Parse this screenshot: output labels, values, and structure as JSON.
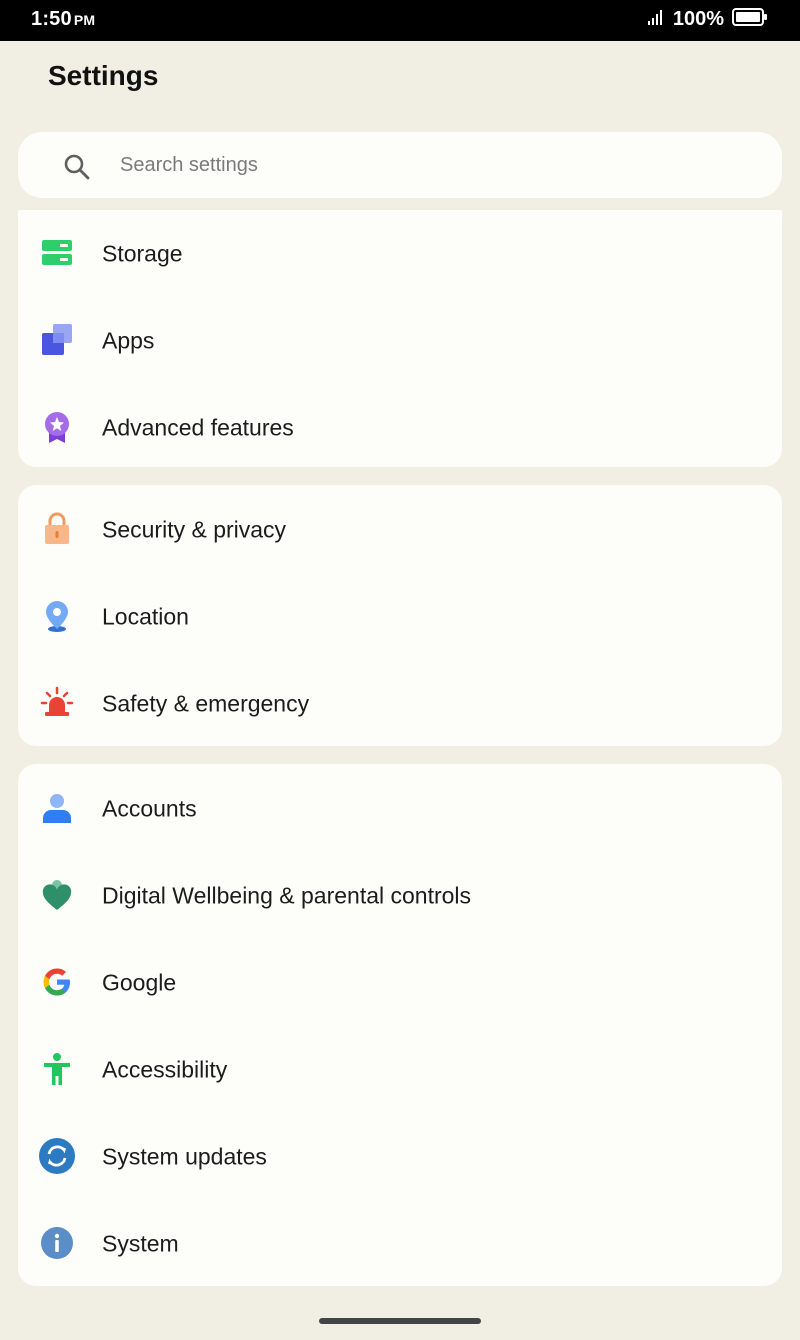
{
  "status_bar": {
    "time": "1:50",
    "ampm": "PM",
    "battery": "100%",
    "icons": [
      "signal-icon",
      "battery-icon"
    ]
  },
  "page": {
    "title": "Settings"
  },
  "search": {
    "placeholder": "Search settings",
    "icon": "search-icon"
  },
  "groups": [
    {
      "items": [
        {
          "label": "Storage",
          "icon": "storage-icon",
          "color": "#2ecf6a"
        },
        {
          "label": "Apps",
          "icon": "apps-icon",
          "color": "#4a63e8"
        },
        {
          "label": "Advanced features",
          "icon": "advanced-features-icon",
          "color": "#9b5de5"
        }
      ]
    },
    {
      "items": [
        {
          "label": "Security & privacy",
          "icon": "lock-icon",
          "color": "#f5a26f"
        },
        {
          "label": "Location",
          "icon": "location-pin-icon",
          "color": "#5a9cf0"
        },
        {
          "label": "Safety & emergency",
          "icon": "emergency-siren-icon",
          "color": "#ea4335"
        }
      ]
    },
    {
      "items": [
        {
          "label": "Accounts",
          "icon": "account-icon",
          "color": "#3b82f6"
        },
        {
          "label": "Digital Wellbeing & parental controls",
          "icon": "wellbeing-heart-icon",
          "color": "#2f8f6b"
        },
        {
          "label": "Google",
          "icon": "google-icon",
          "color": "#4285f4"
        },
        {
          "label": "Accessibility",
          "icon": "accessibility-icon",
          "color": "#22c55e"
        },
        {
          "label": "System updates",
          "icon": "system-updates-icon",
          "color": "#2c7bc2"
        },
        {
          "label": "System",
          "icon": "info-icon",
          "color": "#5b8ec7"
        }
      ]
    }
  ]
}
